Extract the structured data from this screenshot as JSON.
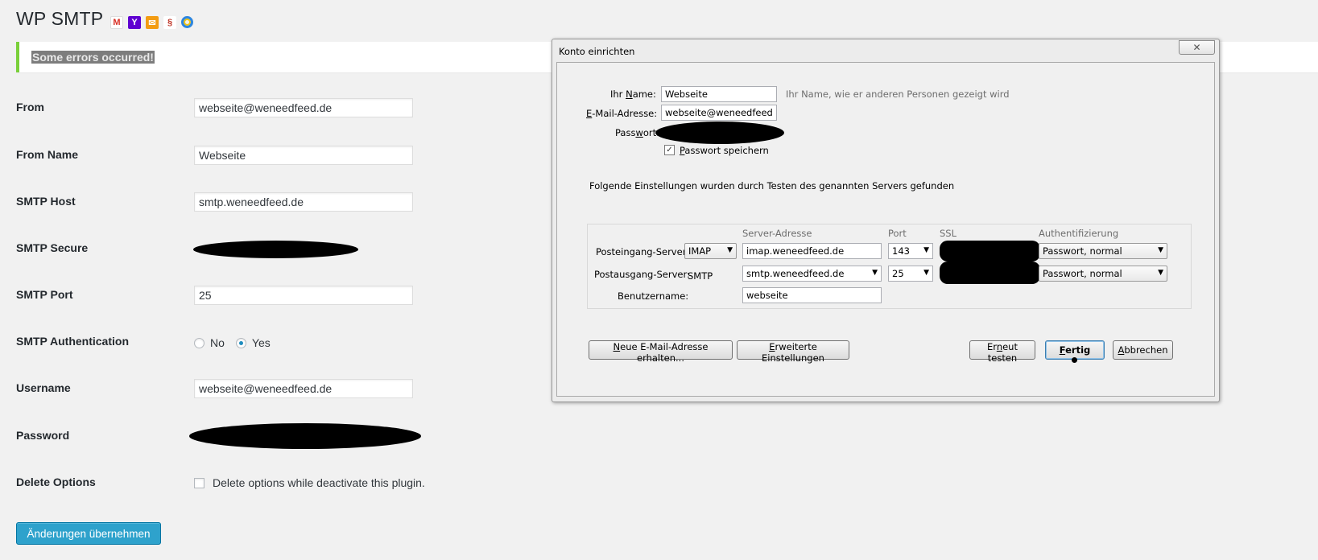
{
  "page": {
    "title": "WP SMTP",
    "icons": [
      "gmail-icon",
      "yahoo-icon",
      "mail-icon",
      "red-logo-icon",
      "colored-ring-icon"
    ],
    "notice": "Some errors occurred!"
  },
  "form": {
    "from_label": "From",
    "from_value": "webseite@weneedfeed.de",
    "from_name_label": "From Name",
    "from_name_value": "Webseite",
    "smtp_host_label": "SMTP Host",
    "smtp_host_value": "smtp.weneedfeed.de",
    "smtp_secure_label": "SMTP Secure",
    "smtp_port_label": "SMTP Port",
    "smtp_port_value": "25",
    "smtp_auth_label": "SMTP Authentication",
    "auth_no": "No",
    "auth_yes": "Yes",
    "auth_selected": "Yes",
    "username_label": "Username",
    "username_value": "webseite@weneedfeed.de",
    "password_label": "Password",
    "delete_options_label": "Delete Options",
    "delete_options_text": "Delete options while deactivate this plugin.",
    "delete_options_checked": false,
    "submit_label": "Änderungen übernehmen"
  },
  "dialog": {
    "title": "Konto einrichten",
    "close_symbol": "✕",
    "name_label_pre": "Ihr ",
    "name_label_u": "N",
    "name_label_post": "ame:",
    "name_value": "Webseite",
    "name_hint": "Ihr Name, wie er anderen Personen gezeigt wird",
    "email_label_u": "E",
    "email_label_post": "-Mail-Adresse:",
    "email_value": "webseite@weneedfeed.de",
    "password_label_pre": "Pass",
    "password_label_u": "w",
    "password_label_post": "ort:",
    "save_password_u": "P",
    "save_password_post": "asswort speichern",
    "save_password_checked": true,
    "found_text": "Folgende Einstellungen wurden durch Testen des genannten Servers gefunden",
    "col_server": "Server-Adresse",
    "col_port": "Port",
    "col_ssl": "SSL",
    "col_auth": "Authentifizierung",
    "incoming_label": "Posteingang-Server:",
    "incoming_protocol": "IMAP",
    "incoming_server": "imap.weneedfeed.de",
    "incoming_port": "143",
    "incoming_auth": "Passwort, normal",
    "outgoing_label": "Postausgang-Server:",
    "outgoing_protocol": "SMTP",
    "outgoing_server": "smtp.weneedfeed.de",
    "outgoing_port": "25",
    "outgoing_auth": "Passwort, normal",
    "username_label": "Benutzername:",
    "username_value": "webseite",
    "btn_new_email_u": "N",
    "btn_new_email_post": "eue E-Mail-Adresse erhalten...",
    "btn_advanced_u": "E",
    "btn_advanced_post": "rweiterte Einstellungen",
    "btn_retest_pre": "Er",
    "btn_retest_u": "n",
    "btn_retest_post": "eut testen",
    "btn_done_u": "F",
    "btn_done_post": "ertig",
    "btn_cancel_u": "A",
    "btn_cancel_post": "bbrechen",
    "arrow_symbol": "▼"
  }
}
